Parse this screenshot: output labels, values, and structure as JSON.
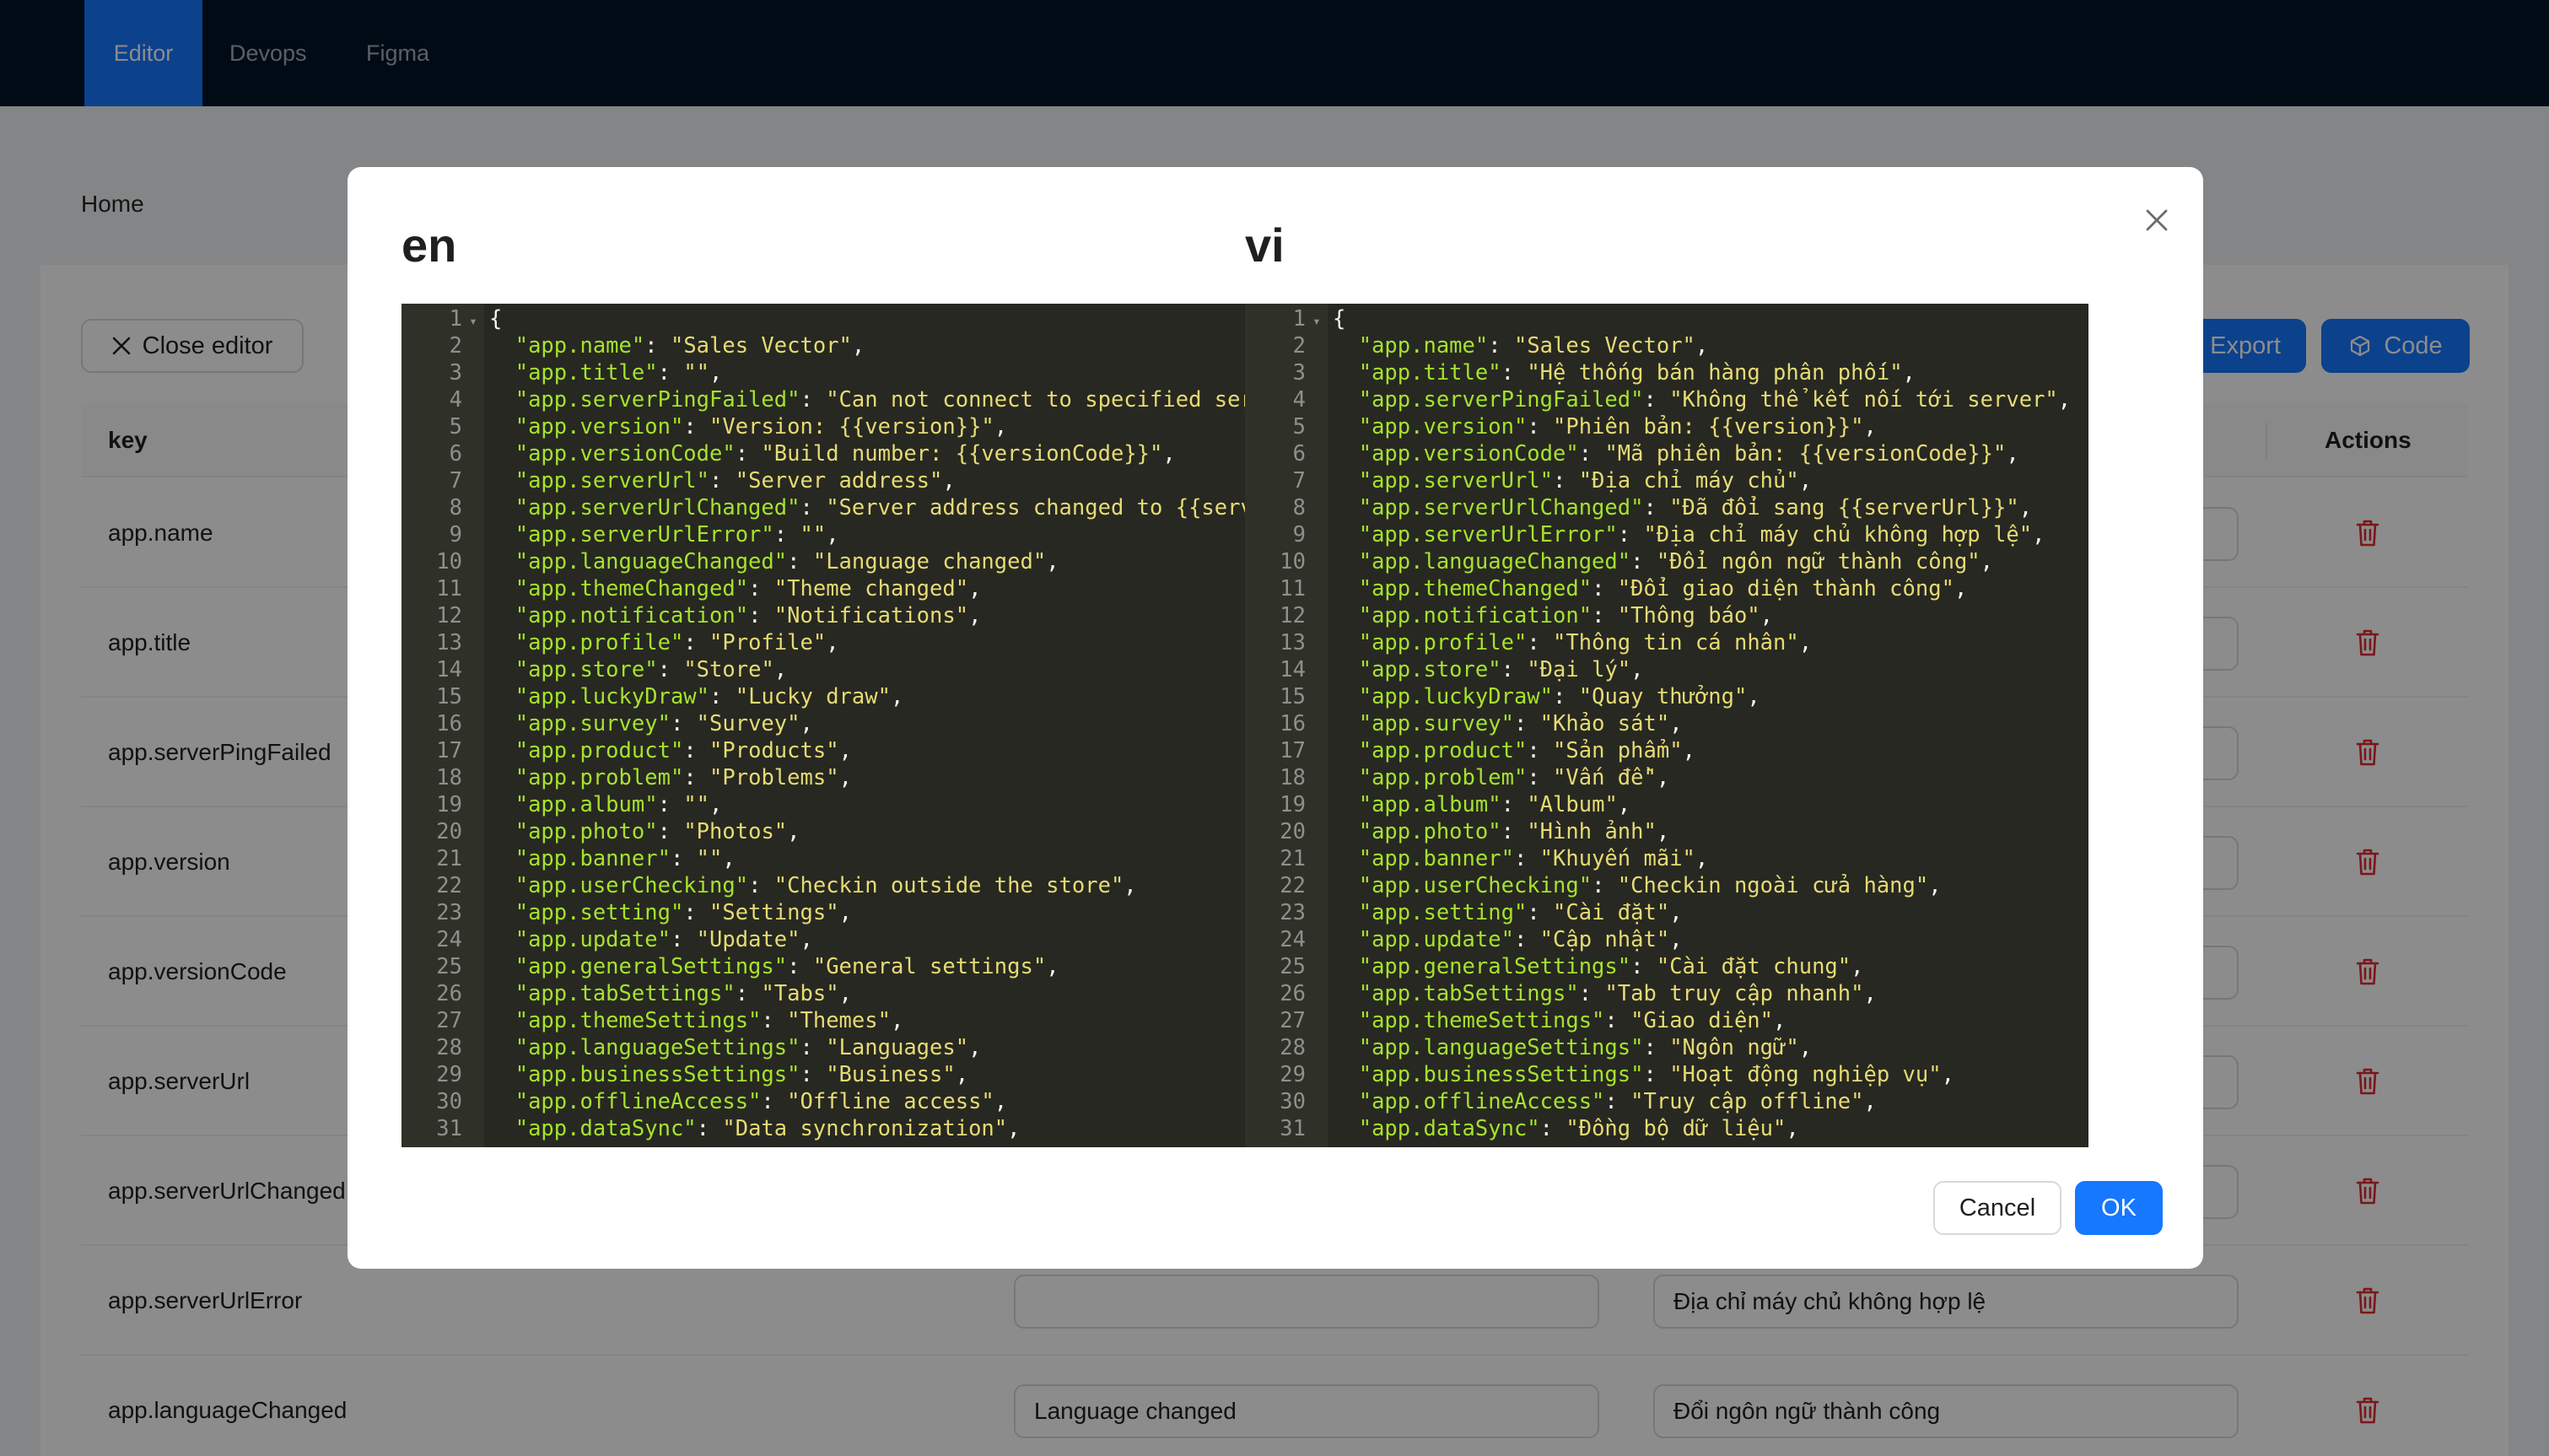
{
  "nav": {
    "items": [
      "Editor",
      "Devops",
      "Figma"
    ]
  },
  "breadcrumb": "Home",
  "toolbar": {
    "close_editor": "Close editor",
    "export": "Export",
    "code": "Code"
  },
  "table": {
    "columns": {
      "key": "key",
      "actions": "Actions"
    },
    "rows": [
      {
        "key": "app.name",
        "en": "",
        "vi": ""
      },
      {
        "key": "app.title",
        "en": "",
        "vi": ""
      },
      {
        "key": "app.serverPingFailed",
        "en": "",
        "vi": ""
      },
      {
        "key": "app.version",
        "en": "",
        "vi": ""
      },
      {
        "key": "app.versionCode",
        "en": "",
        "vi": ""
      },
      {
        "key": "app.serverUrl",
        "en": "",
        "vi": ""
      },
      {
        "key": "app.serverUrlChanged",
        "en": "",
        "vi": ""
      },
      {
        "key": "app.serverUrlError",
        "en": "",
        "vi": "Địa chỉ máy chủ không hợp lệ"
      },
      {
        "key": "app.languageChanged",
        "en": "Language changed",
        "vi": "Đổi ngôn ngữ thành công"
      }
    ]
  },
  "modal": {
    "left_title": "en",
    "right_title": "vi",
    "cancel": "Cancel",
    "ok": "OK",
    "en_lines": [
      {
        "k": "",
        "v": "",
        "raw": "{"
      },
      {
        "k": "app.name",
        "v": "Sales Vector"
      },
      {
        "k": "app.title",
        "v": ""
      },
      {
        "k": "app.serverPingFailed",
        "v": "Can not connect to specified server"
      },
      {
        "k": "app.version",
        "v": "Version: {{version}}"
      },
      {
        "k": "app.versionCode",
        "v": "Build number: {{versionCode}}"
      },
      {
        "k": "app.serverUrl",
        "v": "Server address"
      },
      {
        "k": "app.serverUrlChanged",
        "v": "Server address changed to {{serverUrl}}"
      },
      {
        "k": "app.serverUrlError",
        "v": ""
      },
      {
        "k": "app.languageChanged",
        "v": "Language changed"
      },
      {
        "k": "app.themeChanged",
        "v": "Theme changed"
      },
      {
        "k": "app.notification",
        "v": "Notifications"
      },
      {
        "k": "app.profile",
        "v": "Profile"
      },
      {
        "k": "app.store",
        "v": "Store"
      },
      {
        "k": "app.luckyDraw",
        "v": "Lucky draw"
      },
      {
        "k": "app.survey",
        "v": "Survey"
      },
      {
        "k": "app.product",
        "v": "Products"
      },
      {
        "k": "app.problem",
        "v": "Problems"
      },
      {
        "k": "app.album",
        "v": ""
      },
      {
        "k": "app.photo",
        "v": "Photos"
      },
      {
        "k": "app.banner",
        "v": ""
      },
      {
        "k": "app.userChecking",
        "v": "Checkin outside the store"
      },
      {
        "k": "app.setting",
        "v": "Settings"
      },
      {
        "k": "app.update",
        "v": "Update"
      },
      {
        "k": "app.generalSettings",
        "v": "General settings"
      },
      {
        "k": "app.tabSettings",
        "v": "Tabs"
      },
      {
        "k": "app.themeSettings",
        "v": "Themes"
      },
      {
        "k": "app.languageSettings",
        "v": "Languages"
      },
      {
        "k": "app.businessSettings",
        "v": "Business"
      },
      {
        "k": "app.offlineAccess",
        "v": "Offline access"
      },
      {
        "k": "app.dataSync",
        "v": "Data synchronization"
      }
    ],
    "vi_lines": [
      {
        "k": "",
        "v": "",
        "raw": "{"
      },
      {
        "k": "app.name",
        "v": "Sales Vector"
      },
      {
        "k": "app.title",
        "v": "Hệ thống bán hàng phân phối"
      },
      {
        "k": "app.serverPingFailed",
        "v": "Không thể kết nối tới server"
      },
      {
        "k": "app.version",
        "v": "Phiên bản: {{version}}"
      },
      {
        "k": "app.versionCode",
        "v": "Mã phiên bản: {{versionCode}}"
      },
      {
        "k": "app.serverUrl",
        "v": "Địa chỉ máy chủ"
      },
      {
        "k": "app.serverUrlChanged",
        "v": "Đã đổi sang {{serverUrl}}"
      },
      {
        "k": "app.serverUrlError",
        "v": "Địa chỉ máy chủ không hợp lệ"
      },
      {
        "k": "app.languageChanged",
        "v": "Đổi ngôn ngữ thành công"
      },
      {
        "k": "app.themeChanged",
        "v": "Đổi giao diện thành công"
      },
      {
        "k": "app.notification",
        "v": "Thông báo"
      },
      {
        "k": "app.profile",
        "v": "Thông tin cá nhân"
      },
      {
        "k": "app.store",
        "v": "Đại lý"
      },
      {
        "k": "app.luckyDraw",
        "v": "Quay thưởng"
      },
      {
        "k": "app.survey",
        "v": "Khảo sát"
      },
      {
        "k": "app.product",
        "v": "Sản phẩm"
      },
      {
        "k": "app.problem",
        "v": "Vấn đề"
      },
      {
        "k": "app.album",
        "v": "Album"
      },
      {
        "k": "app.photo",
        "v": "Hình ảnh"
      },
      {
        "k": "app.banner",
        "v": "Khuyến mãi"
      },
      {
        "k": "app.userChecking",
        "v": "Checkin ngoài cửa hàng"
      },
      {
        "k": "app.setting",
        "v": "Cài đặt"
      },
      {
        "k": "app.update",
        "v": "Cập nhật"
      },
      {
        "k": "app.generalSettings",
        "v": "Cài đặt chung"
      },
      {
        "k": "app.tabSettings",
        "v": "Tab truy cập nhanh"
      },
      {
        "k": "app.themeSettings",
        "v": "Giao diện"
      },
      {
        "k": "app.languageSettings",
        "v": "Ngôn ngữ"
      },
      {
        "k": "app.businessSettings",
        "v": "Hoạt động nghiệp vụ"
      },
      {
        "k": "app.offlineAccess",
        "v": "Truy cập offline"
      },
      {
        "k": "app.dataSync",
        "v": "Đồng bộ dữ liệu"
      }
    ]
  }
}
